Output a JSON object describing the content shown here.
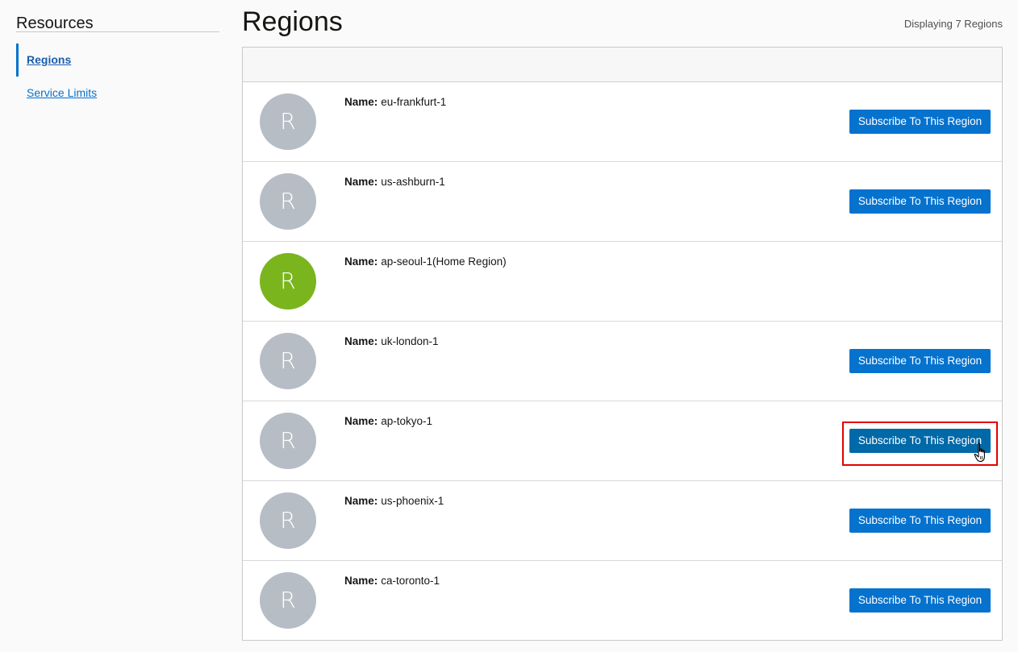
{
  "sidebar": {
    "title": "Resources",
    "items": [
      {
        "label": "Regions",
        "active": true
      },
      {
        "label": "Service Limits",
        "active": false
      }
    ]
  },
  "header": {
    "title": "Regions",
    "count_text": "Displaying 7 Regions"
  },
  "regions": [
    {
      "avatar": "R",
      "name_label": "Name:",
      "name": "eu-frankfurt-1",
      "button": "Subscribe To This Region"
    },
    {
      "avatar": "R",
      "name_label": "Name:",
      "name": "us-ashburn-1",
      "button": "Subscribe To This Region"
    },
    {
      "avatar": "R",
      "name_label": "Name:",
      "name": "ap-seoul-1(Home Region)",
      "button": ""
    },
    {
      "avatar": "R",
      "name_label": "Name:",
      "name": "uk-london-1",
      "button": "Subscribe To This Region"
    },
    {
      "avatar": "R",
      "name_label": "Name:",
      "name": "ap-tokyo-1",
      "button": "Subscribe To This Region"
    },
    {
      "avatar": "R",
      "name_label": "Name:",
      "name": "us-phoenix-1",
      "button": "Subscribe To This Region"
    },
    {
      "avatar": "R",
      "name_label": "Name:",
      "name": "ca-toronto-1",
      "button": "Subscribe To This Region"
    }
  ],
  "colors": {
    "accent": "#0572ce",
    "avatar_default": "#b6bdc5",
    "avatar_home": "#7ab51d",
    "highlight": "#e50000"
  },
  "icons": {
    "cursor": "hand-pointer-icon"
  }
}
